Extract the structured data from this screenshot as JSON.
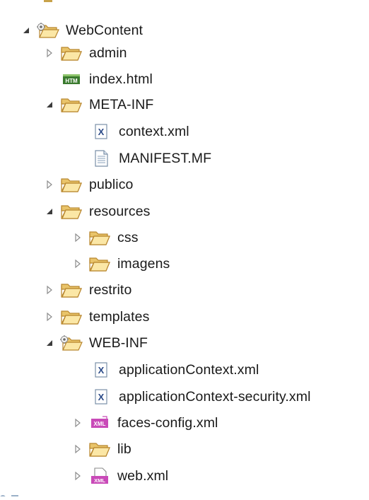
{
  "tree": {
    "root": {
      "label": "WebContent",
      "expanded": true,
      "icon": "project-folder-icon"
    },
    "admin": {
      "label": "admin",
      "expanded": false,
      "icon": "folder-icon"
    },
    "index_html": {
      "label": "index.html",
      "icon": "html-file-icon"
    },
    "meta_inf": {
      "label": "META-INF",
      "expanded": true,
      "icon": "folder-icon"
    },
    "context_xml": {
      "label": "context.xml",
      "icon": "xml-file-icon"
    },
    "manifest_mf": {
      "label": "MANIFEST.MF",
      "icon": "text-file-icon"
    },
    "publico": {
      "label": "publico",
      "expanded": false,
      "icon": "folder-icon"
    },
    "resources": {
      "label": "resources",
      "expanded": true,
      "icon": "folder-icon"
    },
    "css": {
      "label": "css",
      "expanded": false,
      "icon": "folder-icon"
    },
    "imagens": {
      "label": "imagens",
      "expanded": false,
      "icon": "folder-icon"
    },
    "restrito": {
      "label": "restrito",
      "expanded": false,
      "icon": "folder-icon"
    },
    "templates": {
      "label": "templates",
      "expanded": false,
      "icon": "folder-icon"
    },
    "web_inf": {
      "label": "WEB-INF",
      "expanded": true,
      "icon": "project-folder-icon"
    },
    "application_context": {
      "label": "applicationContext.xml",
      "icon": "xml-file-icon"
    },
    "application_context_security": {
      "label": "applicationContext-security.xml",
      "icon": "xml-file-icon"
    },
    "faces_config": {
      "label": "faces-config.xml",
      "expanded": false,
      "icon": "xml-editor-file-icon"
    },
    "lib": {
      "label": "lib",
      "expanded": false,
      "icon": "folder-icon"
    },
    "web_xml": {
      "label": "web.xml",
      "expanded": false,
      "icon": "web-xml-file-icon"
    }
  }
}
